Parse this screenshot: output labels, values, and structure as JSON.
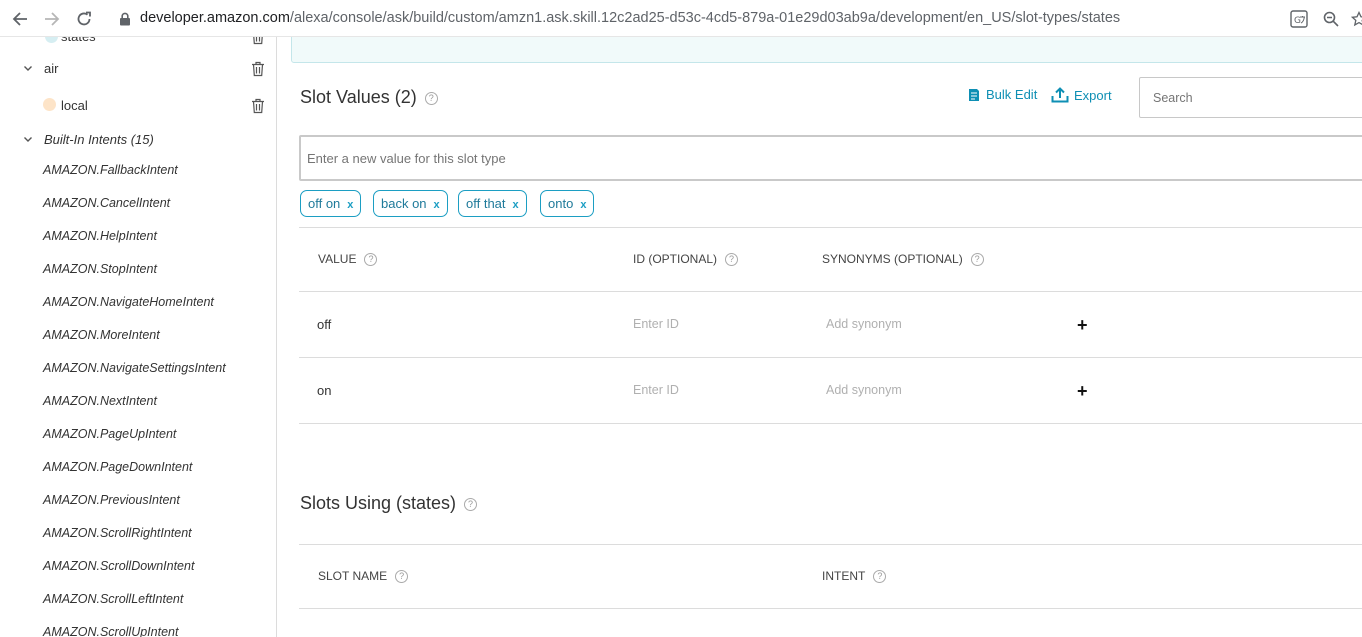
{
  "browser": {
    "url_host": "developer.amazon.com",
    "url_path": "/alexa/console/ask/build/custom/amzn1.ask.skill.12c2ad25-d53c-4cd5-879a-01e29d03ab9a/development/en_US/slot-types/states"
  },
  "sidebar": {
    "top_partial_item": "states",
    "group_air": "air",
    "air_child": "local",
    "builtin_header": "Built-In Intents (15)",
    "intents": [
      "AMAZON.FallbackIntent",
      "AMAZON.CancelIntent",
      "AMAZON.HelpIntent",
      "AMAZON.StopIntent",
      "AMAZON.NavigateHomeIntent",
      "AMAZON.MoreIntent",
      "AMAZON.NavigateSettingsIntent",
      "AMAZON.NextIntent",
      "AMAZON.PageUpIntent",
      "AMAZON.PageDownIntent",
      "AMAZON.PreviousIntent",
      "AMAZON.ScrollRightIntent",
      "AMAZON.ScrollDownIntent",
      "AMAZON.ScrollLeftIntent",
      "AMAZON.ScrollUpIntent"
    ]
  },
  "slot_values": {
    "title": "Slot Values (2)",
    "help": "?",
    "bulk_edit": "Bulk Edit",
    "export": "Export",
    "search_placeholder": "Search",
    "new_value_placeholder": "Enter a new value for this slot type",
    "chips": [
      "off on",
      "back on",
      "off that",
      "onto"
    ],
    "chip_remove": "x",
    "columns": [
      "VALUE",
      "ID (OPTIONAL)",
      "SYNONYMS (OPTIONAL)"
    ],
    "rows": [
      {
        "value": "off",
        "id_placeholder": "Enter ID",
        "synonym_placeholder": "Add synonym",
        "add": "+"
      },
      {
        "value": "on",
        "id_placeholder": "Enter ID",
        "synonym_placeholder": "Add synonym",
        "add": "+"
      }
    ]
  },
  "slots_using": {
    "title": "Slots Using (states)",
    "columns": [
      "SLOT NAME",
      "INTENT"
    ]
  },
  "colors": {
    "accent": "#0e8fb4",
    "chip_border": "#1c9ec3",
    "local_dot": "#fde4c8"
  }
}
